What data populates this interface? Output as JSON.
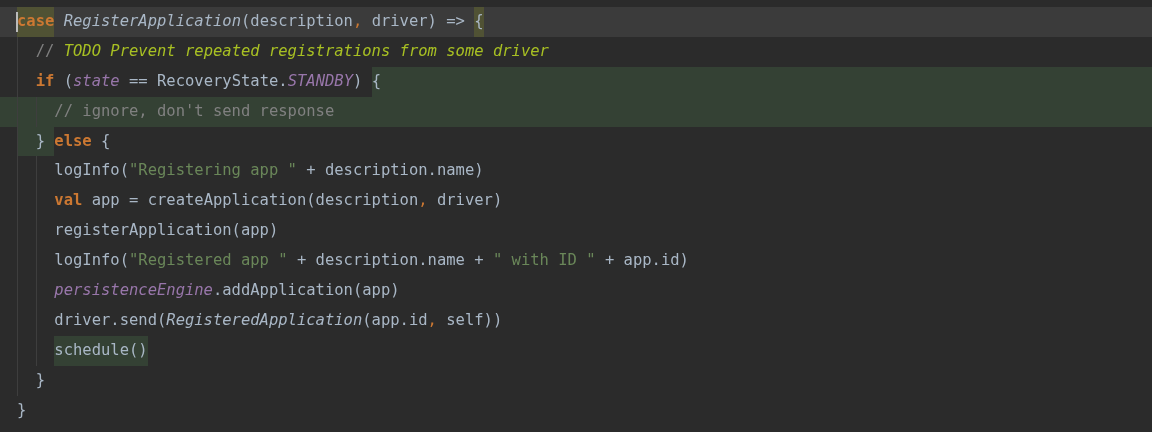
{
  "editor": {
    "lines": [
      {
        "current": true,
        "caret": true,
        "tokens": [
          {
            "text": "case",
            "kind": "keyword",
            "matched": true
          },
          {
            "text": " RegisterApplication",
            "kind": "type"
          },
          {
            "text": "(description",
            "kind": "plain"
          },
          {
            "text": ", ",
            "kind": "comma"
          },
          {
            "text": "driver) => ",
            "kind": "plain"
          },
          {
            "text": "{",
            "kind": "plain",
            "matched": true
          }
        ],
        "children": [
          {
            "tokens": [
              {
                "text": "// ",
                "kind": "comment"
              },
              {
                "text": "TODO Prevent repeated registrations from some driver",
                "kind": "todo"
              }
            ]
          },
          {
            "shade_to_end": true,
            "tokens": [
              {
                "text": "if",
                "kind": "keyword"
              },
              {
                "text": " (",
                "kind": "plain"
              },
              {
                "text": "state",
                "kind": "field"
              },
              {
                "text": " == RecoveryState.",
                "kind": "plain"
              },
              {
                "text": "STANDBY",
                "kind": "field"
              },
              {
                "text": ") ",
                "kind": "plain"
              },
              {
                "text": "{",
                "kind": "plain",
                "shaded": true
              }
            ],
            "children": [
              {
                "shaded": true,
                "tokens": [
                  {
                    "text": "// ignore, don't send response",
                    "kind": "comment"
                  }
                ]
              }
            ]
          },
          {
            "shade_from_start": true,
            "tokens": [
              {
                "text": "} ",
                "kind": "plain",
                "shaded": true
              },
              {
                "text": "else",
                "kind": "keyword"
              },
              {
                "text": " {",
                "kind": "plain"
              }
            ],
            "children": [
              {
                "tokens": [
                  {
                    "text": "logInfo(",
                    "kind": "plain"
                  },
                  {
                    "text": "\"Registering app \"",
                    "kind": "string"
                  },
                  {
                    "text": " + description.name)",
                    "kind": "plain"
                  }
                ]
              },
              {
                "tokens": [
                  {
                    "text": "val",
                    "kind": "keyword"
                  },
                  {
                    "text": " app = createApplication(description",
                    "kind": "plain"
                  },
                  {
                    "text": ", ",
                    "kind": "comma"
                  },
                  {
                    "text": "driver)",
                    "kind": "plain"
                  }
                ]
              },
              {
                "tokens": [
                  {
                    "text": "registerApplication(app)",
                    "kind": "plain"
                  }
                ]
              },
              {
                "tokens": [
                  {
                    "text": "logInfo(",
                    "kind": "plain"
                  },
                  {
                    "text": "\"Registered app \"",
                    "kind": "string"
                  },
                  {
                    "text": " + description.name + ",
                    "kind": "plain"
                  },
                  {
                    "text": "\" with ID \"",
                    "kind": "string"
                  },
                  {
                    "text": " + app.id)",
                    "kind": "plain"
                  }
                ]
              },
              {
                "tokens": [
                  {
                    "text": "persistenceEngine",
                    "kind": "field"
                  },
                  {
                    "text": ".addApplication(app)",
                    "kind": "plain"
                  }
                ]
              },
              {
                "tokens": [
                  {
                    "text": "driver.send(",
                    "kind": "plain"
                  },
                  {
                    "text": "RegisteredApplication",
                    "kind": "type"
                  },
                  {
                    "text": "(app.id",
                    "kind": "plain"
                  },
                  {
                    "text": ", ",
                    "kind": "comma"
                  },
                  {
                    "text": "self))",
                    "kind": "plain"
                  }
                ]
              },
              {
                "tokens": [
                  {
                    "text": "schedule()",
                    "kind": "plain",
                    "shaded": true
                  }
                ]
              }
            ]
          },
          {
            "tokens": [
              {
                "text": "}",
                "kind": "plain"
              }
            ]
          }
        ]
      },
      {
        "tokens": [
          {
            "text": "}",
            "kind": "plain"
          }
        ]
      }
    ]
  }
}
